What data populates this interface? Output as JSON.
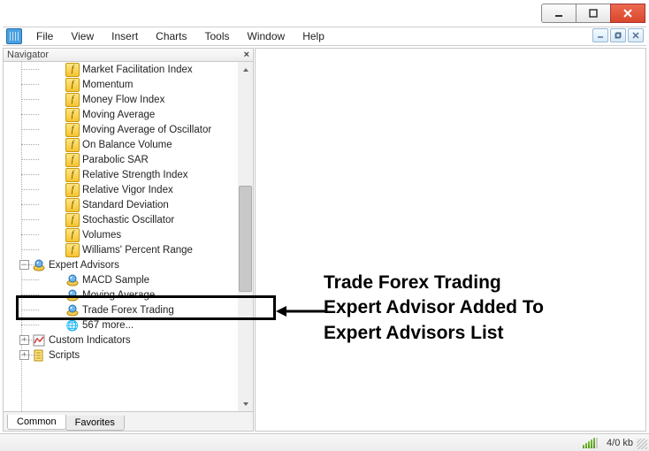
{
  "menu": {
    "file": "File",
    "view": "View",
    "insert": "Insert",
    "charts": "Charts",
    "tools": "Tools",
    "window": "Window",
    "help": "Help"
  },
  "navigator": {
    "title": "Navigator",
    "indicators": [
      "Market Facilitation Index",
      "Momentum",
      "Money Flow Index",
      "Moving Average",
      "Moving Average of Oscillator",
      "On Balance Volume",
      "Parabolic SAR",
      "Relative Strength Index",
      "Relative Vigor Index",
      "Standard Deviation",
      "Stochastic Oscillator",
      "Volumes",
      "Williams' Percent Range"
    ],
    "ea_group": "Expert Advisors",
    "eas": [
      "MACD Sample",
      "Moving Average",
      "Trade Forex Trading"
    ],
    "ea_more": "567 more...",
    "ci_group": "Custom Indicators",
    "sc_group": "Scripts",
    "tabs": {
      "common": "Common",
      "favorites": "Favorites"
    }
  },
  "status": {
    "kb": "4/0 kb"
  },
  "annotation": {
    "line1": "Trade Forex Trading",
    "line2": "Expert Advisor Added To",
    "line3": "Expert Advisors List"
  }
}
